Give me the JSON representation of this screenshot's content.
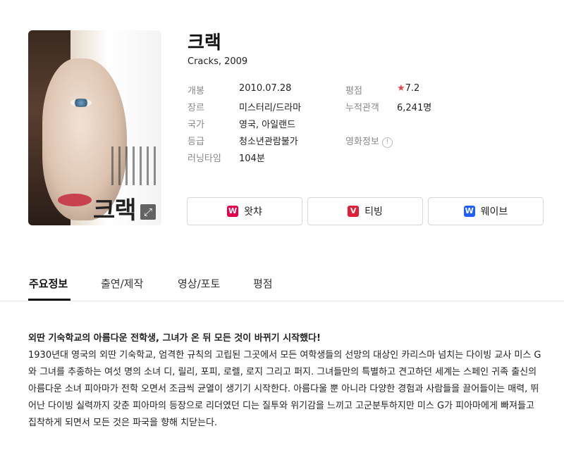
{
  "poster": {
    "title_text": "크랙",
    "expand_icon": "expand-icon"
  },
  "movie": {
    "title": "크랙",
    "subtitle": "Cracks, 2009"
  },
  "info_left": [
    {
      "label": "개봉",
      "value": "2010.07.28"
    },
    {
      "label": "장르",
      "value": "미스터리/드라마"
    },
    {
      "label": "국가",
      "value": "영국, 아일랜드"
    },
    {
      "label": "등급",
      "value": "청소년관람불가"
    },
    {
      "label": "러닝타임",
      "value": "104분"
    }
  ],
  "info_right": {
    "rating_label": "평점",
    "rating_star": "★",
    "rating_value": "7.2",
    "audience_label": "누적관객",
    "audience_value": "6,241명",
    "movieinfo_label": "영화정보",
    "movieinfo_icon": "!"
  },
  "ott": [
    {
      "label": "왓챠",
      "logo": "W",
      "color": "#e4004f"
    },
    {
      "label": "티빙",
      "logo": "V",
      "color": "#e01e38"
    },
    {
      "label": "웨이브",
      "logo": "W",
      "color": "#1f5eff"
    }
  ],
  "tabs": [
    "주요정보",
    "출연/제작",
    "영상/포토",
    "평점"
  ],
  "synopsis": {
    "headline": "외딴 기숙학교의 아름다운 전학생, 그녀가 온 뒤 모든 것이 바뀌기 시작했다!",
    "body": "1930년대 영국의 외딴 기숙학교, 엄격한 규칙의 고립된 그곳에서 모든 여학생들의 선망의 대상인 카리스마 넘치는 다이빙 교사 미스 G와 그녀를 추종하는 여섯 명의 소녀 디, 릴리, 포피, 로렐, 로지 그리고 퍼지. 그녀들만의 특별하고 견고하던 세계는 스페인 귀족 출신의 아름다운 소녀 피아마가 전학 오면서 조금씩 균열이 생기기 시작한다. 아름다울 뿐 아니라 다양한 경험과 사람들을 끌어들이는 매력, 뛰어난 다이빙 실력까지 갖춘 피아마의 등장으로 리더였던 디는 질투와 위기감을 느끼고 고군분투하지만 미스 G가 피아마에게 빠져들고 집착하게 되면서 모든 것은 파국을 향해 치닫는다."
  }
}
